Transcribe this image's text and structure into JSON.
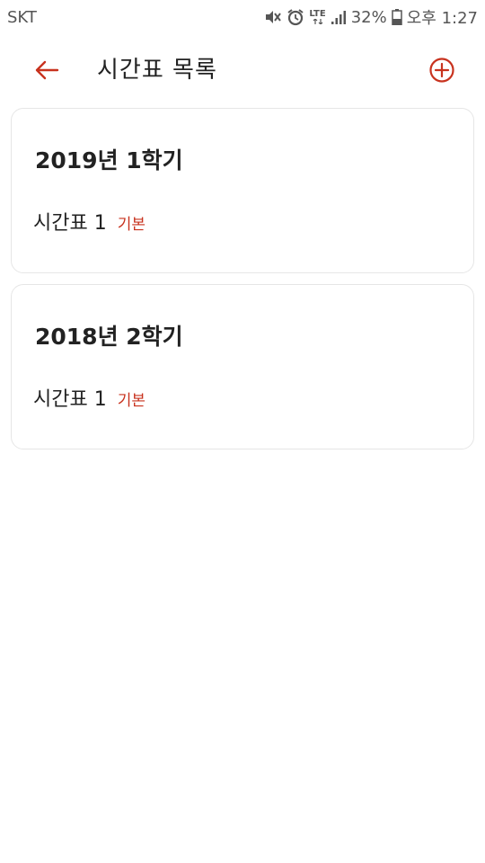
{
  "status_bar": {
    "carrier": "SKT",
    "network": "LTE",
    "battery": "32%",
    "time": "오후 1:27"
  },
  "header": {
    "title": "시간표 목록"
  },
  "colors": {
    "accent": "#c8321e",
    "card_border": "#e6e6e6",
    "text": "#222222"
  },
  "semesters": [
    {
      "title": "2019년 1학기",
      "timetable_name": "시간표 1",
      "badge": "기본"
    },
    {
      "title": "2018년 2학기",
      "timetable_name": "시간표 1",
      "badge": "기본"
    }
  ]
}
